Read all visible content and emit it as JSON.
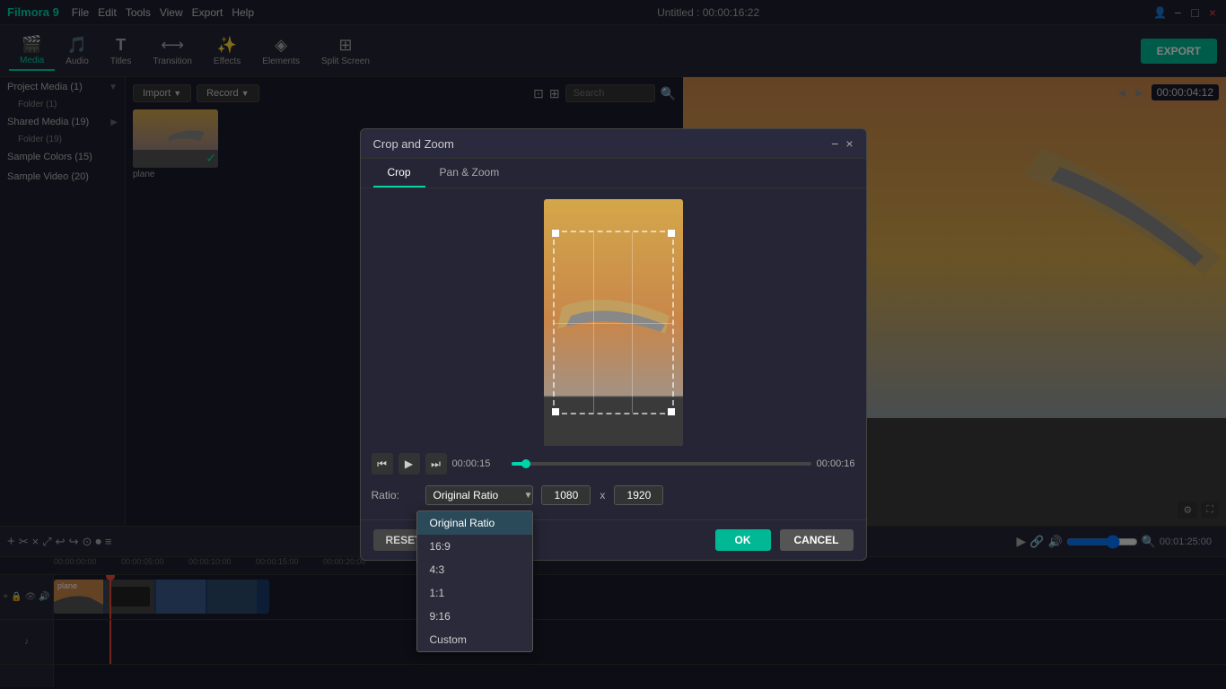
{
  "app": {
    "name": "Filmora 9",
    "title": "Untitled : 00:00:16:22"
  },
  "menu": {
    "items": [
      "File",
      "Edit",
      "Tools",
      "View",
      "Export",
      "Help"
    ]
  },
  "window_controls": {
    "minimize": "−",
    "maximize": "□",
    "close": "×"
  },
  "toolbar": {
    "items": [
      {
        "id": "media",
        "icon": "🎬",
        "label": "Media",
        "active": true
      },
      {
        "id": "audio",
        "icon": "🎵",
        "label": "Audio",
        "active": false
      },
      {
        "id": "titles",
        "icon": "T",
        "label": "Titles",
        "active": false
      },
      {
        "id": "transition",
        "icon": "⟷",
        "label": "Transition",
        "active": false
      },
      {
        "id": "effects",
        "icon": "✨",
        "label": "Effects",
        "active": false
      },
      {
        "id": "elements",
        "icon": "◈",
        "label": "Elements",
        "active": false
      },
      {
        "id": "splitscreen",
        "icon": "⊞",
        "label": "Split Screen",
        "active": false
      }
    ],
    "export_label": "EXPORT"
  },
  "left_panel": {
    "items": [
      {
        "label": "Project Media (1)",
        "count": "1",
        "expandable": true
      },
      {
        "label": "Folder (1)",
        "sub": true,
        "count": "1"
      },
      {
        "label": "Shared Media (19)",
        "count": "19",
        "expandable": true
      },
      {
        "label": "Folder (19)",
        "sub": true,
        "count": "19"
      },
      {
        "label": "Sample Colors (15)",
        "count": "15"
      },
      {
        "label": "Sample Video (20)",
        "count": "20"
      }
    ]
  },
  "media_toolbar": {
    "import_label": "Import",
    "record_label": "Record",
    "filter_icon": "⊡",
    "grid_icon": "⊞",
    "search_placeholder": "Search"
  },
  "media_item": {
    "label": "plane",
    "checked": true
  },
  "timeline": {
    "current_time": "00:00:04:12",
    "times": [
      "00:00:00:00",
      "00:00:05:00",
      "00:00:10:00",
      "00:00:15:00",
      "00:00:20:00"
    ],
    "track_label": "plane",
    "buttons": [
      "⟲",
      "✂",
      "×",
      "⤢",
      "↩",
      "↪",
      "⊙",
      "🔲",
      "≡"
    ]
  },
  "crop_dialog": {
    "title": "Crop and Zoom",
    "minimize": "−",
    "close": "×",
    "tabs": [
      {
        "id": "crop",
        "label": "Crop",
        "active": true
      },
      {
        "id": "pan_zoom",
        "label": "Pan & Zoom",
        "active": false
      }
    ],
    "playback": {
      "rewind_btn": "⏮",
      "play_btn": "▶",
      "forward_btn": "⏭",
      "current_time": "00:00:15",
      "end_time": "00:00:16",
      "progress_pct": 5
    },
    "ratio": {
      "label": "Ratio:",
      "selected": "Original Ratio",
      "options": [
        "Original Ratio",
        "16:9",
        "4:3",
        "1:1",
        "9:16",
        "Custom"
      ],
      "width": "1080",
      "height": "1920",
      "separator": "x"
    },
    "reset_label": "RESET",
    "ok_label": "OK",
    "cancel_label": "CANCEL",
    "dropdown_visible": true,
    "dropdown_items": [
      {
        "label": "Original Ratio",
        "selected": true
      },
      {
        "label": "16:9",
        "selected": false
      },
      {
        "label": "4:3",
        "selected": false
      },
      {
        "label": "1:1",
        "selected": false
      },
      {
        "label": "9:16",
        "selected": false
      },
      {
        "label": "Custom",
        "selected": false
      }
    ]
  }
}
